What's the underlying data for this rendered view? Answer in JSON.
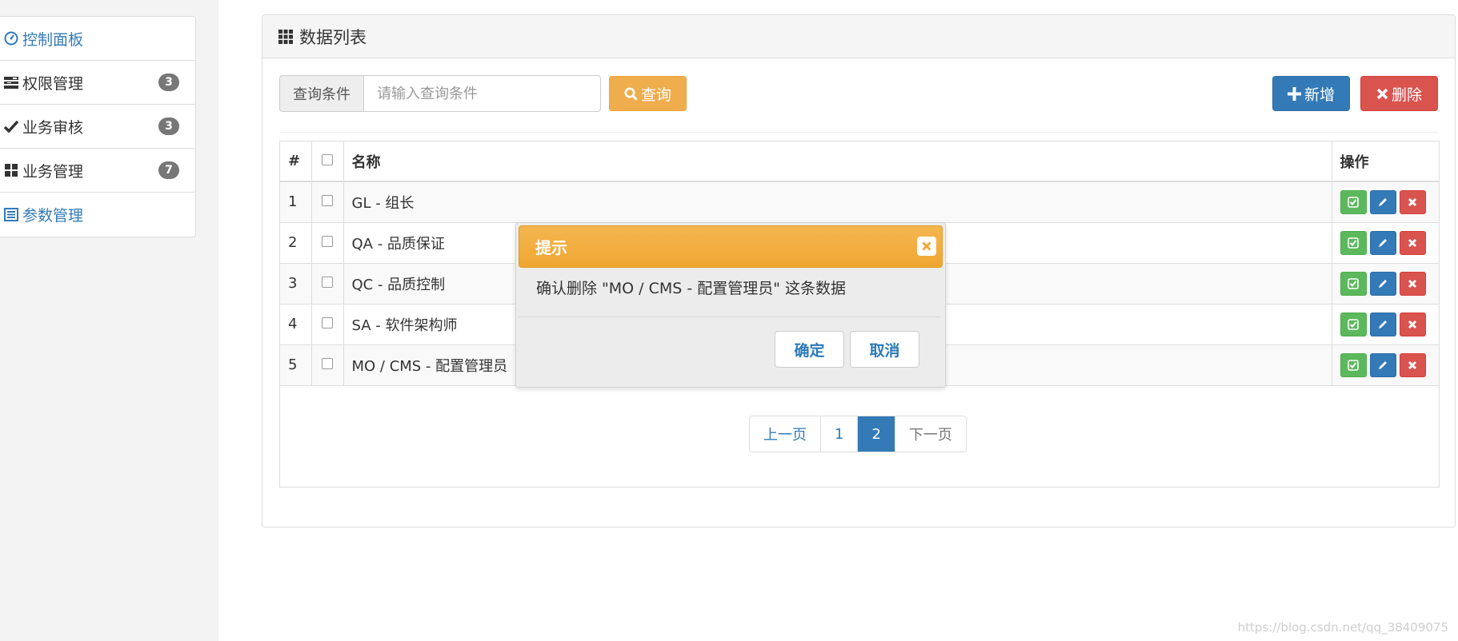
{
  "sidebar": {
    "items": [
      {
        "label": "控制面板",
        "icon": "dashboard-icon",
        "badge": ""
      },
      {
        "label": "权限管理",
        "icon": "tasks-icon",
        "badge": "3"
      },
      {
        "label": "业务审核",
        "icon": "check-icon",
        "badge": "3"
      },
      {
        "label": "业务管理",
        "icon": "grid-icon",
        "badge": "7"
      },
      {
        "label": "参数管理",
        "icon": "list-alt-icon",
        "badge": ""
      }
    ]
  },
  "panel": {
    "title": "数据列表",
    "title_icon": "th-icon"
  },
  "toolbar": {
    "query_addon": "查询条件",
    "query_placeholder": "请输入查询条件",
    "search_label": "查询",
    "add_label": "新增",
    "delete_label": "删除"
  },
  "table": {
    "headers": {
      "index": "#",
      "name": "名称",
      "ops": "操作"
    },
    "rows": [
      {
        "index": "1",
        "name": "GL - 组长"
      },
      {
        "index": "2",
        "name": "QA - 品质保证"
      },
      {
        "index": "3",
        "name": "QC - 品质控制"
      },
      {
        "index": "4",
        "name": "SA - 软件架构师"
      },
      {
        "index": "5",
        "name": "MO / CMS - 配置管理员"
      }
    ]
  },
  "pagination": {
    "prev": "上一页",
    "pages": [
      "1",
      "2"
    ],
    "current": "2",
    "next": "下一页"
  },
  "dialog": {
    "title": "提示",
    "message": "确认删除 \"MO / CMS - 配置管理员\" 这条数据",
    "ok": "确定",
    "cancel": "取消"
  },
  "watermark": "https://blog.csdn.net/qq_38409075",
  "colors": {
    "primary": "#337ab7",
    "warning": "#f0ad4e",
    "danger": "#d9534f",
    "success": "#5cb85c",
    "badge": "#777777"
  }
}
